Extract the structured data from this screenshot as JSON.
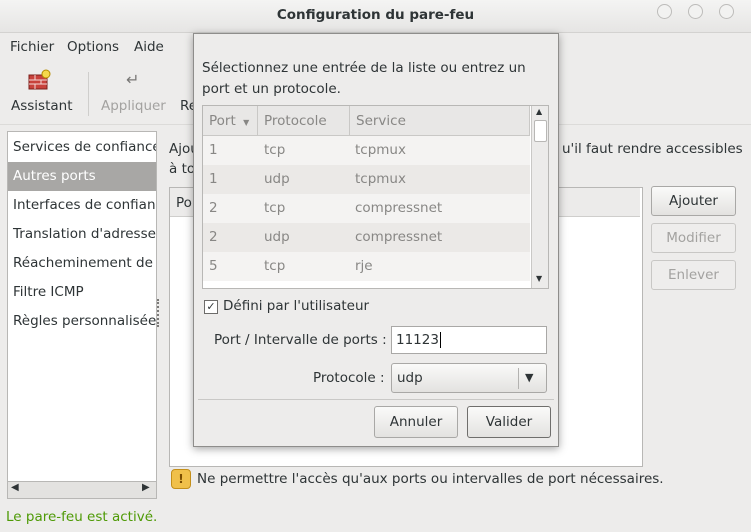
{
  "window": {
    "title": "Configuration du pare-feu"
  },
  "menubar": {
    "items": [
      "Fichier",
      "Options",
      "Aide"
    ]
  },
  "toolbar": {
    "assistant": "Assistant",
    "apply": "Appliquer",
    "reload": "Re"
  },
  "sidebar": {
    "items": [
      "Services de confiance",
      "Autres ports",
      "Interfaces de confiance",
      "Translation d'adresses",
      "Réacheminement de p",
      "Filtre ICMP",
      "Règles personnalisées"
    ],
    "selected_index": 1
  },
  "content": {
    "intro_line1": "Ajou",
    "intro_line1_right": "u'il faut rendre accessibles",
    "intro_line2": "à to",
    "table_head_partial": "Po",
    "add_label": "Ajouter",
    "modify_label": "Modifier",
    "remove_label": "Enlever",
    "warning": "Ne permettre l'accès qu'aux ports ou intervalles de port nécessaires."
  },
  "status": {
    "text": "Le pare-feu est activé.",
    "color": "#4e9a06"
  },
  "dialog": {
    "prompt_line1": "Sélectionnez une entrée de la liste ou entrez un",
    "prompt_line2": "port et un protocole.",
    "columns": [
      "Port",
      "Protocole",
      "Service"
    ],
    "rows": [
      {
        "port": "1",
        "protocol": "tcp",
        "service": "tcpmux"
      },
      {
        "port": "1",
        "protocol": "udp",
        "service": "tcpmux"
      },
      {
        "port": "2",
        "protocol": "tcp",
        "service": "compressnet"
      },
      {
        "port": "2",
        "protocol": "udp",
        "service": "compressnet"
      },
      {
        "port": "5",
        "protocol": "tcp",
        "service": "rje"
      }
    ],
    "user_defined_label": "Défini par l'utilisateur",
    "user_defined_checked": true,
    "port_label": "Port / Intervalle de ports :",
    "port_value": "11123",
    "protocol_label": "Protocole :",
    "protocol_value": "udp",
    "cancel_label": "Annuler",
    "ok_label": "Valider"
  }
}
